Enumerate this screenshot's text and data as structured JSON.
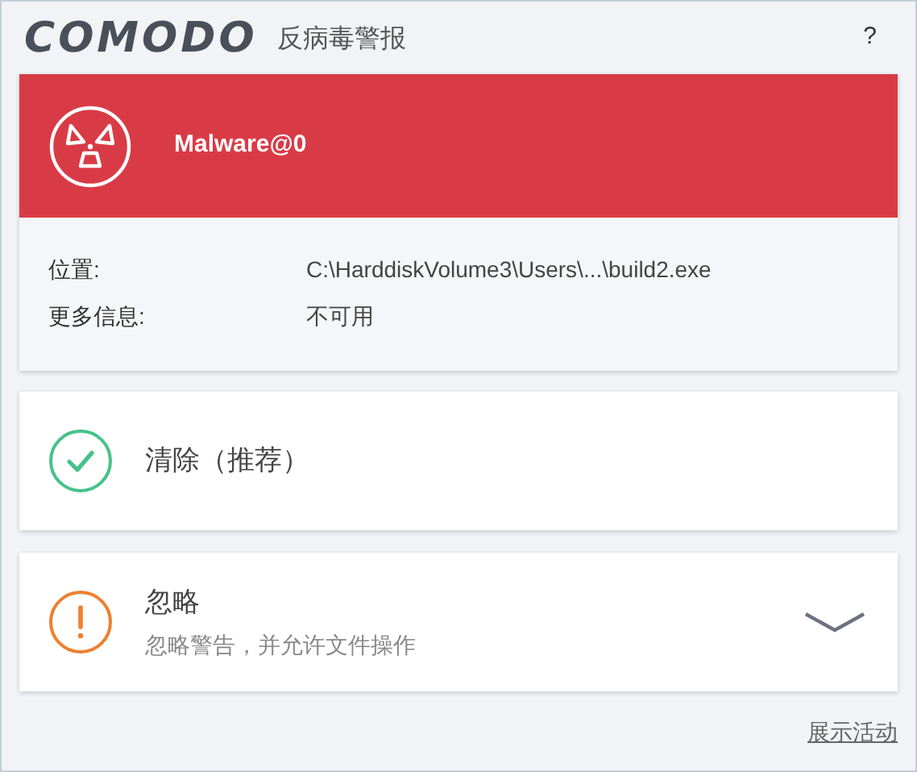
{
  "header": {
    "logo": "COMODO",
    "title": "反病毒警报",
    "help": "?"
  },
  "alert": {
    "threat": "Malware@0",
    "details": [
      {
        "label": "位置:",
        "value": "C:\\HarddiskVolume3\\Users\\...\\build2.exe"
      },
      {
        "label": "更多信息:",
        "value": "不可用"
      }
    ]
  },
  "options": [
    {
      "kind": "clean",
      "label": "清除（推荐）",
      "expandable": false
    },
    {
      "kind": "ignore",
      "label": "忽略",
      "description": "忽略警告，并允许文件操作",
      "expandable": true
    }
  ],
  "footer_link": "展示活动"
}
